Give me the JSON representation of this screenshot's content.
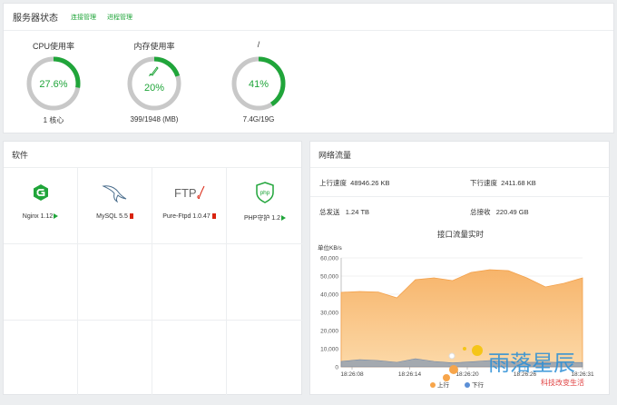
{
  "status": {
    "title": "服务器状态",
    "links": [
      "连接管理",
      "进程管理"
    ],
    "gauges": [
      {
        "label": "CPU使用率",
        "value_text": "27.6%",
        "percent": 27.6,
        "sub": "1 核心"
      },
      {
        "label": "内存使用率",
        "value_text": "20%",
        "percent": 20,
        "sub": "399/1948 (MB)"
      },
      {
        "label": "/",
        "value_text": "41%",
        "percent": 41,
        "sub": "7.4G/19G"
      }
    ]
  },
  "software": {
    "title": "软件",
    "items": [
      {
        "name": "Nginx 1.12",
        "status": "running"
      },
      {
        "name": "MySQL 5.5",
        "status": "stopped"
      },
      {
        "name": "Pure-Ftpd 1.0.47",
        "status": "stopped"
      },
      {
        "name": "PHP守护 1.2",
        "status": "running"
      }
    ]
  },
  "network": {
    "title": "网络流量",
    "up_speed_label": "上行速度",
    "up_speed": "48946.26 KB",
    "down_speed_label": "下行速度",
    "down_speed": "2411.68 KB",
    "total_sent_label": "总发送",
    "total_sent": "1.24 TB",
    "total_recv_label": "总接收",
    "total_recv": "220.49 GB",
    "chart_title": "接口流量实时",
    "unit_label": "单位KB/s"
  },
  "colors": {
    "accent": "#20a53a",
    "upstream": "#f7a54a",
    "downstream": "#5b8fd6"
  },
  "chart_data": {
    "type": "area",
    "title": "接口流量实时",
    "ylabel": "单位KB/s",
    "ylim": [
      0,
      60000
    ],
    "yticks": [
      "60,000",
      "50,000",
      "40,000",
      "30,000",
      "20,000",
      "10,000",
      "0"
    ],
    "x_tick_labels": [
      "18:26:08",
      "18:26:14",
      "18:26:20",
      "18:26:26",
      "18:26:31"
    ],
    "grid": true,
    "legend_position": "bottom",
    "series": [
      {
        "name": "上行",
        "color": "#f7a54a",
        "values": [
          41000,
          41500,
          41200,
          38000,
          48000,
          49000,
          47500,
          52000,
          53500,
          53000,
          49000,
          44000,
          46000,
          49000
        ]
      },
      {
        "name": "下行",
        "color": "#5b8fd6",
        "values": [
          3000,
          4000,
          3500,
          2500,
          4500,
          3000,
          2200,
          2800,
          3500,
          3000,
          2500,
          2600,
          2400,
          2411
        ]
      }
    ]
  },
  "watermark": {
    "main": "雨落星辰",
    "sub": "科技改变生活"
  }
}
